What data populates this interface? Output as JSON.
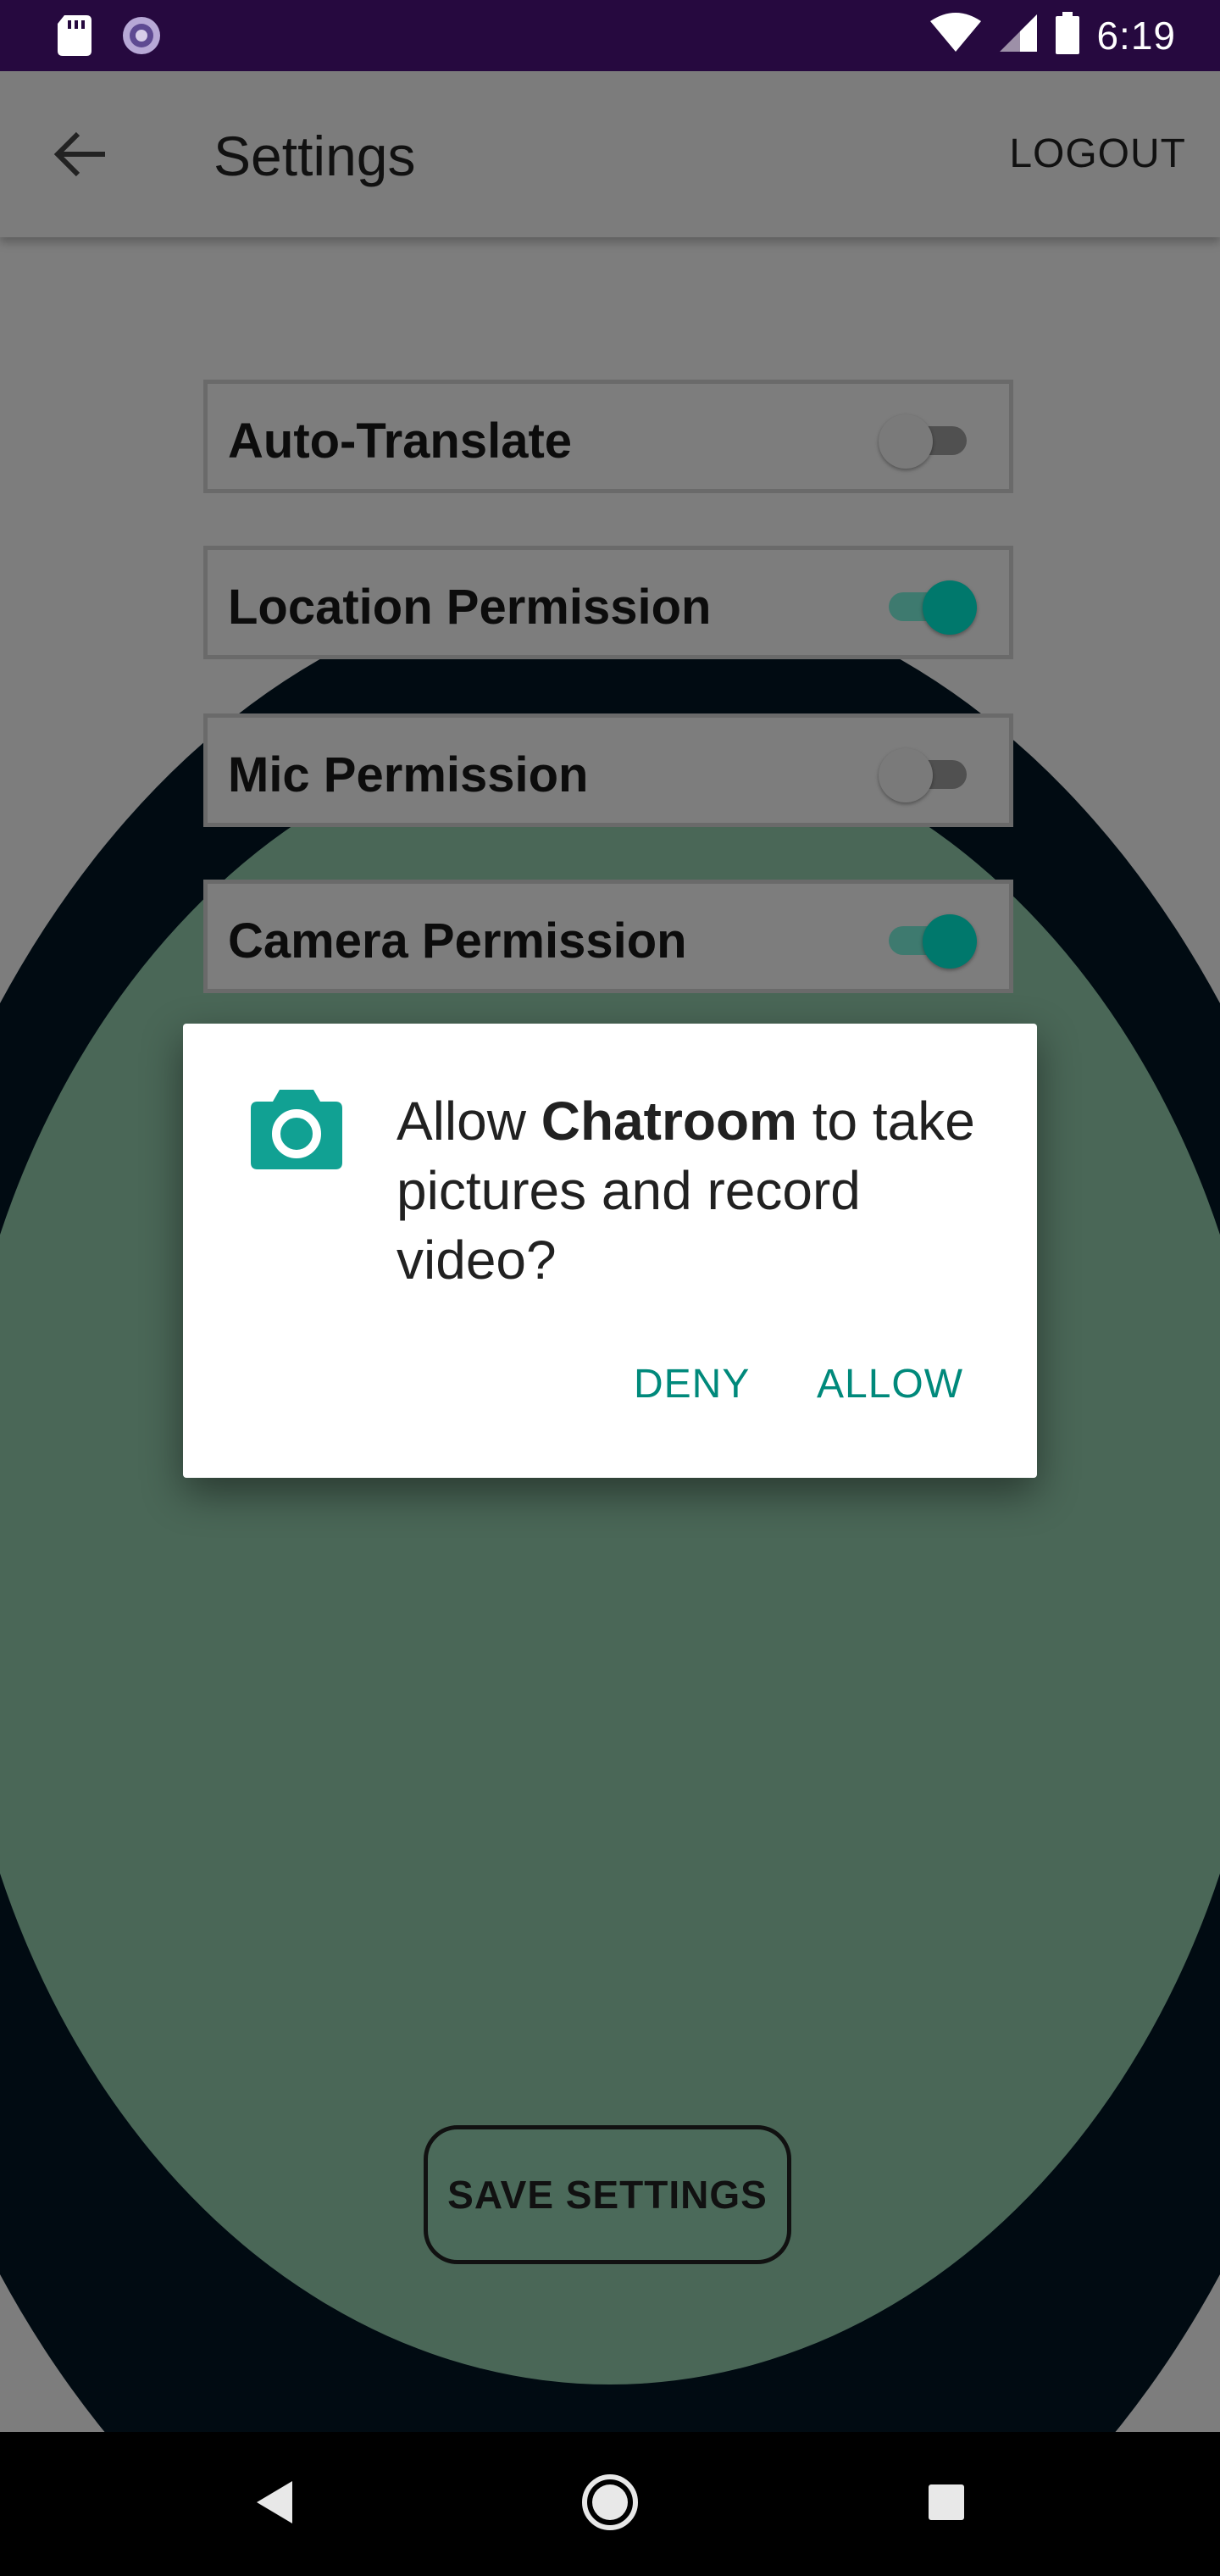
{
  "status_bar": {
    "time": "6:19",
    "icons": [
      "sd-card-icon",
      "loading-icon",
      "wifi-icon",
      "signal-icon",
      "battery-icon"
    ]
  },
  "toolbar": {
    "title": "Settings",
    "logout_label": "LOGOUT",
    "back_icon": "arrow-left-icon"
  },
  "settings": [
    {
      "label": "Auto-Translate",
      "enabled": false
    },
    {
      "label": "Location Permission",
      "enabled": true
    },
    {
      "label": "Mic Permission",
      "enabled": false
    },
    {
      "label": "Camera Permission",
      "enabled": true
    }
  ],
  "save_button_label": "SAVE SETTINGS",
  "dialog": {
    "icon": "camera-icon",
    "message_prefix": "Allow ",
    "app_name": "Chatroom",
    "message_suffix": " to take pictures and record video?",
    "deny_label": "DENY",
    "allow_label": "ALLOW"
  },
  "nav_bar": {
    "icons": [
      "back-triangle-icon",
      "home-circle-icon",
      "recents-square-icon"
    ]
  },
  "colors": {
    "status_bar": "#26093f",
    "accent": "#00897b",
    "switch_on": "#00786c"
  }
}
